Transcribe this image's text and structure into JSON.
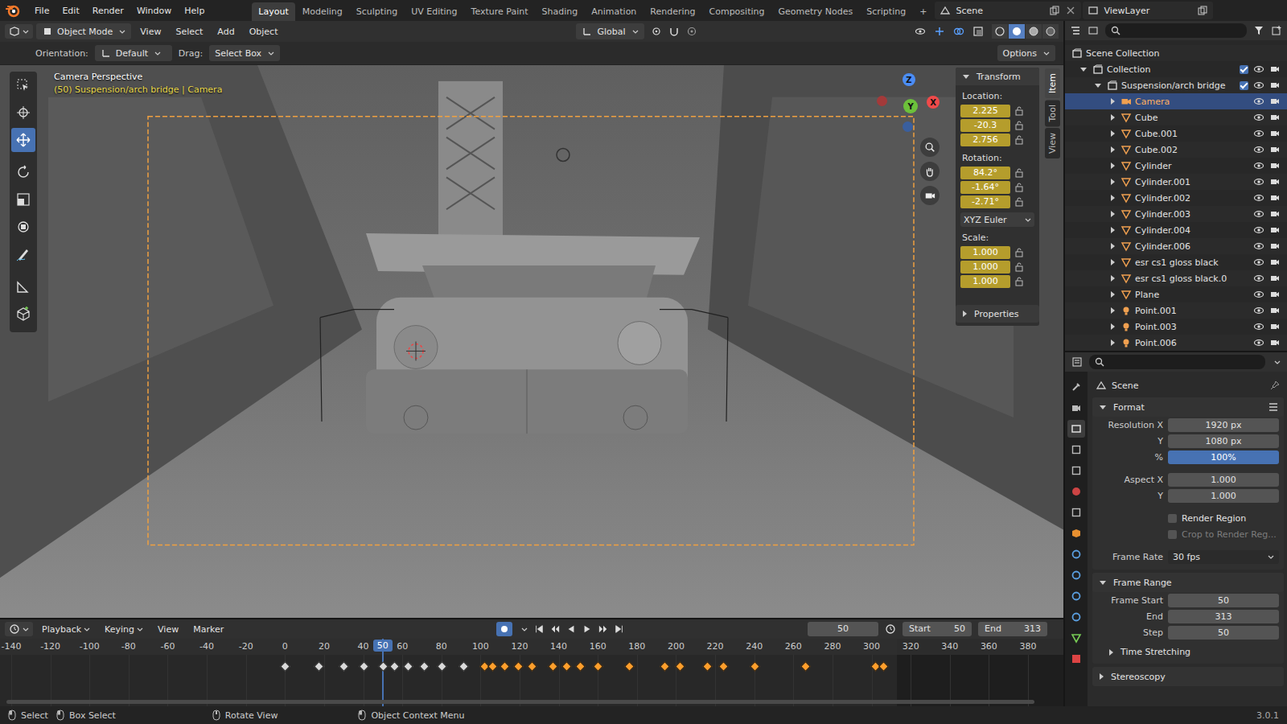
{
  "window": {
    "title": "Blender"
  },
  "menu": [
    "File",
    "Edit",
    "Render",
    "Window",
    "Help"
  ],
  "workspaces": [
    {
      "label": "Layout",
      "selected": true
    },
    {
      "label": "Modeling",
      "selected": false
    },
    {
      "label": "Sculpting",
      "selected": false
    },
    {
      "label": "UV Editing",
      "selected": false
    },
    {
      "label": "Texture Paint",
      "selected": false
    },
    {
      "label": "Shading",
      "selected": false
    },
    {
      "label": "Animation",
      "selected": false
    },
    {
      "label": "Rendering",
      "selected": false
    },
    {
      "label": "Compositing",
      "selected": false
    },
    {
      "label": "Geometry Nodes",
      "selected": false
    },
    {
      "label": "Scripting",
      "selected": false
    }
  ],
  "add_workspace": "+",
  "scene": "Scene",
  "view_layer": "ViewLayer",
  "viewport_header": {
    "mode": "Object Mode",
    "menus": [
      "View",
      "Select",
      "Add",
      "Object"
    ],
    "orientation": "Global",
    "shading": [
      {
        "kind": "wireframe",
        "selected": false
      },
      {
        "kind": "solid",
        "selected": true
      },
      {
        "kind": "material",
        "selected": false
      },
      {
        "kind": "rendered",
        "selected": false
      }
    ]
  },
  "tool_settings": {
    "orientation_label": "Orientation:",
    "orientation": "Default",
    "drag_label": "Drag:",
    "drag": "Select Box",
    "options": "Options"
  },
  "tools": [
    {
      "kind": "select",
      "selected": false
    },
    {
      "kind": "cursor",
      "selected": false
    },
    {
      "kind": "move",
      "selected": true
    },
    {
      "kind": "rotate",
      "selected": false
    },
    {
      "kind": "scale",
      "selected": false
    },
    {
      "kind": "transform",
      "selected": false
    },
    {
      "kind": "annotate",
      "selected": false
    },
    {
      "kind": "measure",
      "selected": false
    },
    {
      "kind": "add",
      "selected": false
    }
  ],
  "overlay": {
    "title": "Camera Perspective",
    "subtitle": "(50) Suspension/arch bridge | Camera"
  },
  "gizmo": {
    "z": "Z",
    "y": "Y",
    "x": "X"
  },
  "n_panel": {
    "tabs": [
      {
        "label": "Item",
        "selected": true
      },
      {
        "label": "Tool",
        "selected": false
      },
      {
        "label": "View",
        "selected": false
      }
    ],
    "section": "Transform",
    "expanded": true,
    "location_label": "Location:",
    "location": [
      "2.225",
      "-20.3",
      "2.756"
    ],
    "rotation_label": "Rotation:",
    "rotation": [
      "84.2°",
      "-1.64°",
      "-2.71°"
    ],
    "rotation_mode": "XYZ Euler",
    "scale_label": "Scale:",
    "scale": [
      "1.000",
      "1.000",
      "1.000"
    ],
    "properties": "Properties"
  },
  "timeline": {
    "menus": [
      "Playback",
      "Keying",
      "View",
      "Marker"
    ],
    "current": "50",
    "start_label": "Start",
    "start": "50",
    "end_label": "End",
    "end": "313",
    "ruler": [
      "-140",
      "-120",
      "-100",
      "-80",
      "-60",
      "-40",
      "-20",
      "0",
      "20",
      "40",
      "60",
      "80",
      "100",
      "120",
      "140",
      "160",
      "180",
      "200",
      "220",
      "240",
      "260",
      "280",
      "300",
      "320",
      "340",
      "360",
      "380"
    ],
    "keyframes": [
      {
        "frame": 0,
        "selected": false
      },
      {
        "frame": 17,
        "selected": false
      },
      {
        "frame": 30,
        "selected": false
      },
      {
        "frame": 40,
        "selected": false
      },
      {
        "frame": 50,
        "selected": false
      },
      {
        "frame": 56,
        "selected": false
      },
      {
        "frame": 63,
        "selected": false
      },
      {
        "frame": 71,
        "selected": false
      },
      {
        "frame": 80,
        "selected": false
      },
      {
        "frame": 91,
        "selected": false
      },
      {
        "frame": 102,
        "selected": true
      },
      {
        "frame": 106,
        "selected": true
      },
      {
        "frame": 112,
        "selected": true
      },
      {
        "frame": 119,
        "selected": true
      },
      {
        "frame": 126,
        "selected": true
      },
      {
        "frame": 137,
        "selected": true
      },
      {
        "frame": 144,
        "selected": true
      },
      {
        "frame": 151,
        "selected": true
      },
      {
        "frame": 160,
        "selected": true
      },
      {
        "frame": 176,
        "selected": true
      },
      {
        "frame": 194,
        "selected": true
      },
      {
        "frame": 202,
        "selected": true
      },
      {
        "frame": 216,
        "selected": true
      },
      {
        "frame": 224,
        "selected": true
      },
      {
        "frame": 240,
        "selected": true
      },
      {
        "frame": 266,
        "selected": true
      },
      {
        "frame": 302,
        "selected": true
      },
      {
        "frame": 306,
        "selected": true
      }
    ]
  },
  "outliner": {
    "root": "Scene Collection",
    "collection": "Collection",
    "collection_checked": true,
    "group": "Suspension/arch bridge",
    "group_checked": true,
    "items": [
      {
        "name": "Camera",
        "kind": "camera",
        "selected": true
      },
      {
        "name": "Cube",
        "kind": "mesh",
        "selected": false
      },
      {
        "name": "Cube.001",
        "kind": "mesh",
        "selected": false
      },
      {
        "name": "Cube.002",
        "kind": "mesh",
        "selected": false
      },
      {
        "name": "Cylinder",
        "kind": "mesh",
        "selected": false
      },
      {
        "name": "Cylinder.001",
        "kind": "mesh",
        "selected": false
      },
      {
        "name": "Cylinder.002",
        "kind": "mesh",
        "selected": false
      },
      {
        "name": "Cylinder.003",
        "kind": "mesh",
        "selected": false
      },
      {
        "name": "Cylinder.004",
        "kind": "mesh",
        "selected": false
      },
      {
        "name": "Cylinder.006",
        "kind": "mesh",
        "selected": false
      },
      {
        "name": "esr cs1 gloss black",
        "kind": "mesh",
        "selected": false
      },
      {
        "name": "esr cs1 gloss black.0",
        "kind": "mesh",
        "selected": false
      },
      {
        "name": "Plane",
        "kind": "mesh",
        "selected": false
      },
      {
        "name": "Point.001",
        "kind": "light",
        "selected": false
      },
      {
        "name": "Point.003",
        "kind": "light",
        "selected": false
      },
      {
        "name": "Point.006",
        "kind": "light",
        "selected": false
      }
    ]
  },
  "properties": {
    "tabs": [
      {
        "kind": "tool",
        "selected": false
      },
      {
        "kind": "render",
        "selected": false
      },
      {
        "kind": "output",
        "selected": true
      },
      {
        "kind": "view-layer",
        "selected": false
      },
      {
        "kind": "scene",
        "selected": false
      },
      {
        "kind": "world",
        "selected": false
      },
      {
        "kind": "collection",
        "selected": false
      },
      {
        "kind": "object",
        "selected": false
      },
      {
        "kind": "modifiers",
        "selected": false
      },
      {
        "kind": "particles",
        "selected": false
      },
      {
        "kind": "physics",
        "selected": false
      },
      {
        "kind": "constraints",
        "selected": false
      },
      {
        "kind": "data",
        "selected": false
      },
      {
        "kind": "texture",
        "selected": false
      }
    ],
    "title": "Scene",
    "format": {
      "label": "Format",
      "expanded": true,
      "rows": [
        {
          "kind": "number",
          "label": "Resolution X",
          "value": "1920 px",
          "group": 1
        },
        {
          "kind": "number",
          "label": "Y",
          "value": "1080 px",
          "group": 1
        },
        {
          "kind": "percent",
          "label": "%",
          "value": "100%",
          "group": 1,
          "selected": true
        },
        {
          "kind": "number",
          "label": "Aspect X",
          "value": "1.000",
          "group": 2
        },
        {
          "kind": "number",
          "label": "Y",
          "value": "1.000",
          "group": 2
        },
        {
          "kind": "checkbox",
          "label": "Render Region",
          "checked": false,
          "disabled": false,
          "group": 3
        },
        {
          "kind": "checkbox",
          "label": "Crop to Render Reg...",
          "checked": false,
          "disabled": true,
          "group": 3
        },
        {
          "kind": "dropdown",
          "label": "Frame Rate",
          "value": "30 fps",
          "group": 4
        }
      ]
    },
    "frame_range": {
      "label": "Frame Range",
      "expanded": true,
      "rows": [
        {
          "label": "Frame Start",
          "value": "50"
        },
        {
          "label": "End",
          "value": "313"
        },
        {
          "label": "Step",
          "value": "50"
        }
      ]
    },
    "time_stretching": {
      "label": "Time Stretching",
      "expanded": false
    },
    "stereoscopy": {
      "label": "Stereoscopy",
      "expanded": false
    }
  },
  "status_bar": {
    "hints": [
      "Select",
      "Box Select",
      "Rotate View",
      "Object Context Menu"
    ],
    "version": "3.0.1"
  }
}
